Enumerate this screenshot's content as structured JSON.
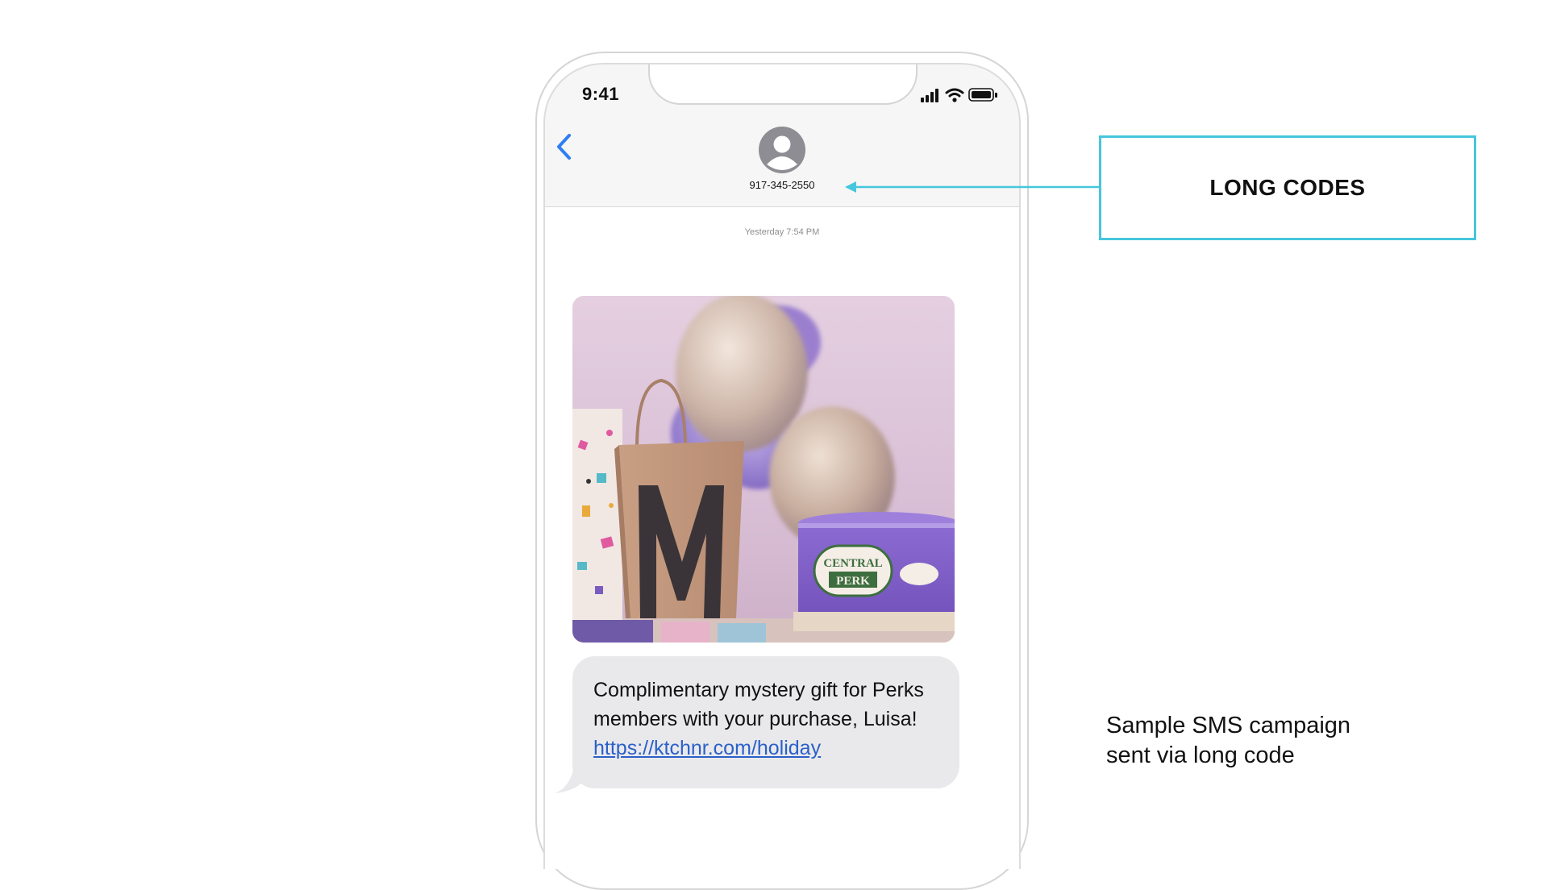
{
  "phone": {
    "status_time": "9:41",
    "contact_number": "917-345-2550",
    "timestamp": "Yesterday 7:54 PM",
    "message": {
      "text": "Complimentary mystery gift for Perks members with your purchase, Luisa! ",
      "link": "https://ktchnr.com/holiday"
    },
    "image": {
      "bag_letter": "M",
      "cake_text_top": "CENTRAL",
      "cake_text_bottom": "PERK"
    }
  },
  "callout": {
    "label": "LONG CODES",
    "color": "#45c7dc"
  },
  "caption": {
    "line1": "Sample SMS campaign",
    "line2": "sent via long code"
  }
}
